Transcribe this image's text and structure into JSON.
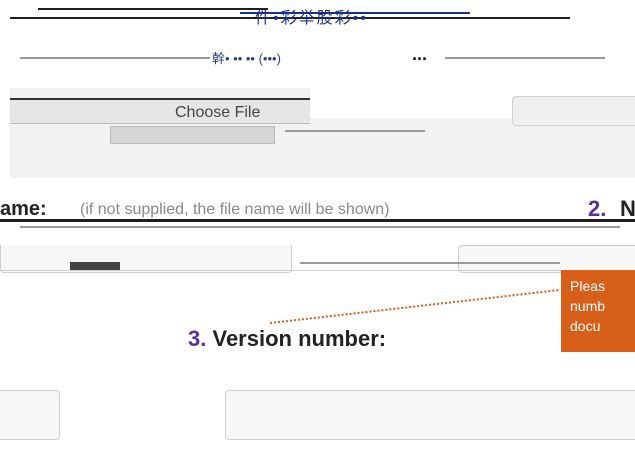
{
  "header": {
    "title_garbled": "件•彩举股彩••",
    "meta_garbled": "幹• •• •• (•••)",
    "ellipsis": "..."
  },
  "upload": {
    "choose_file": "Choose File"
  },
  "name_section": {
    "label": "ame",
    "colon": ":",
    "hint": "(if not supplied, the file name will be shown)",
    "next_number": "2.",
    "next_label": "N"
  },
  "version_section": {
    "number": "3.",
    "label": "Version number:"
  },
  "callout": {
    "lines": [
      "Pleas",
      "numb",
      "docu"
    ]
  }
}
